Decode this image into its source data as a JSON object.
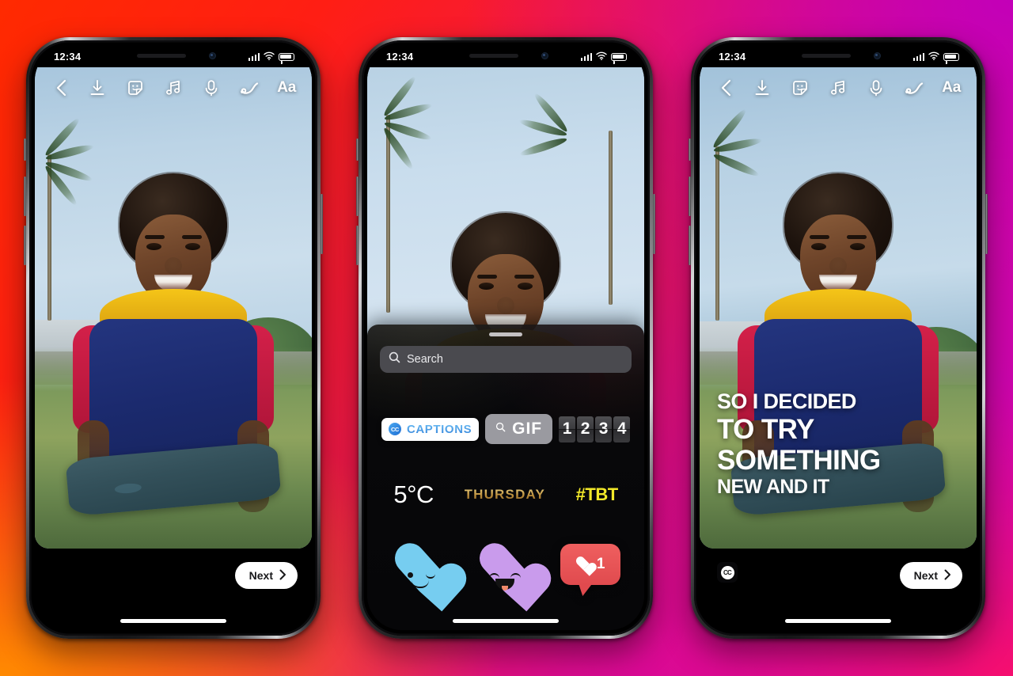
{
  "background": {
    "gradient_colors": [
      "#ff2a00",
      "#ff1e14",
      "#f0174f",
      "#d4089c",
      "#c200c2",
      "#ff8a00"
    ]
  },
  "status_bar": {
    "time": "12:34",
    "signal_icon": "cellular-bars-icon",
    "wifi_icon": "wifi-icon",
    "battery_icon": "battery-icon"
  },
  "toolbar": {
    "back_icon": "chevron-left-icon",
    "items": [
      {
        "icon": "download-icon",
        "label": "Save"
      },
      {
        "icon": "sticker-icon",
        "label": "Stickers"
      },
      {
        "icon": "music-note-icon",
        "label": "Music"
      },
      {
        "icon": "microphone-icon",
        "label": "Voice"
      },
      {
        "icon": "draw-squiggle-icon",
        "label": "Draw"
      },
      {
        "icon": "text-icon",
        "label": "Aa"
      }
    ],
    "text_label": "Aa"
  },
  "next_button": {
    "label": "Next",
    "chevron_icon": "chevron-right-icon"
  },
  "sticker_tray": {
    "grabber_icon": "drag-handle-icon",
    "search": {
      "placeholder": "Search",
      "value": "Search",
      "icon": "search-icon"
    },
    "row1": {
      "captions": {
        "label": "CAPTIONS",
        "icon": "cc-icon",
        "accent": "#2f7fd8"
      },
      "gif": {
        "label": "GIF",
        "icon": "search-icon"
      },
      "countdown": {
        "digits": [
          "1",
          "2",
          "3",
          "4"
        ]
      }
    },
    "row2": {
      "temperature": "5°C",
      "weekday": "THURSDAY",
      "hashtag": "#TBT",
      "weekday_color": "#b98b3a",
      "hashtag_color": "#f2e829"
    },
    "row3": {
      "heart_blue": {
        "name": "winking-heart-sticker",
        "color": "#76cdf0"
      },
      "heart_purple": {
        "name": "smiling-heart-sticker",
        "color": "#c99bec"
      },
      "like_badge": {
        "name": "like-notification-sticker",
        "count": "1",
        "color": "#e04a4e"
      }
    }
  },
  "captions_overlay": {
    "lines": [
      "SO I DECIDED",
      "TO TRY",
      "SOMETHING",
      "NEW AND IT"
    ],
    "cc_badge": "CC"
  },
  "phones": [
    {
      "id": "phone-1",
      "screen": "story-editor"
    },
    {
      "id": "phone-2",
      "screen": "sticker-tray"
    },
    {
      "id": "phone-3",
      "screen": "captions-preview"
    }
  ]
}
